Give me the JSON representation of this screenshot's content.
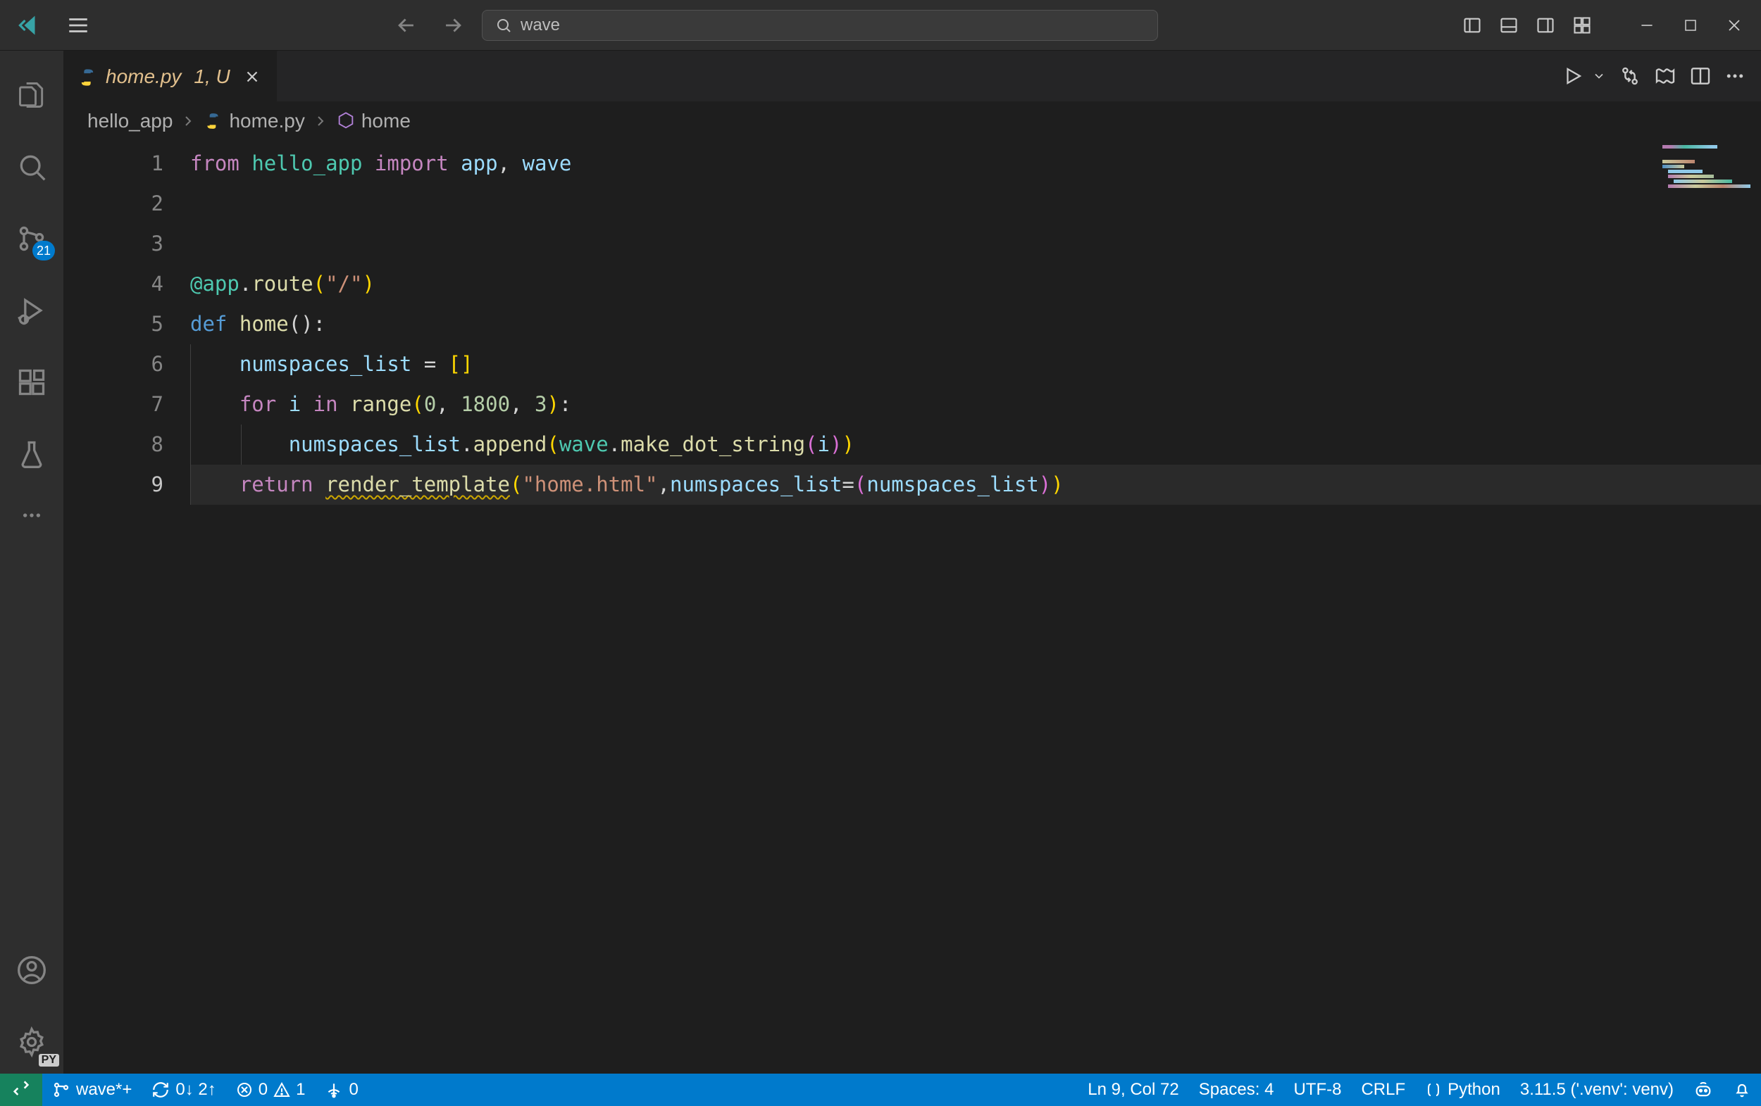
{
  "titlebar": {
    "search_text": "wave"
  },
  "tab": {
    "filename": "home.py",
    "modified_indicator": "1, U"
  },
  "tabs_actions": {
    "run_tooltip": "Run"
  },
  "breadcrumb": {
    "folder": "hello_app",
    "file": "home.py",
    "symbol": "home"
  },
  "activitybar": {
    "scm_badge": "21",
    "settings_badge": "PY"
  },
  "code": {
    "1": {
      "kw_from": "from",
      "mod": "hello_app",
      "kw_import": "import",
      "v1": "app",
      "comma": ",",
      "v2": "wave"
    },
    "4": {
      "dec": "@app",
      "dot": ".",
      "route": "route",
      "lp": "(",
      "str": "\"/\"",
      "rp": ")"
    },
    "5": {
      "def": "def",
      "name": "home",
      "parens": "():"
    },
    "6": {
      "var": "numspaces_list",
      "eq": " = ",
      "br": "[]"
    },
    "7": {
      "for": "for",
      "i": "i",
      "in": "in",
      "range": "range",
      "lp": "(",
      "a": "0",
      "c1": ", ",
      "b": "1800",
      "c2": ", ",
      "c": "3",
      "rp": ")",
      "colon": ":"
    },
    "8": {
      "obj": "numspaces_list",
      "dot": ".",
      "app": "append",
      "lp": "(",
      "wave": "wave",
      "dot2": ".",
      "mds": "make_dot_string",
      "lp2": "(",
      "i": "i",
      "rp2": ")",
      "rp": ")"
    },
    "9": {
      "ret": "return",
      "rt": "render_template",
      "lp": "(",
      "s": "\"home.html\"",
      "comma": ",",
      "kw": "numspaces_list",
      "eq": "=",
      "lp2": "(",
      "var": "numspaces_list",
      "rp2": ")",
      "rp": ")"
    }
  },
  "line_numbers": [
    "1",
    "2",
    "3",
    "4",
    "5",
    "6",
    "7",
    "8",
    "9"
  ],
  "status": {
    "branch": "wave*+",
    "sync": "0↓ 2↑",
    "errors": "0",
    "warnings": "1",
    "ports": "0",
    "cursor": "Ln 9, Col 72",
    "spaces": "Spaces: 4",
    "encoding": "UTF-8",
    "eol": "CRLF",
    "lang": "Python",
    "interpreter": "3.11.5 ('.venv': venv)"
  }
}
